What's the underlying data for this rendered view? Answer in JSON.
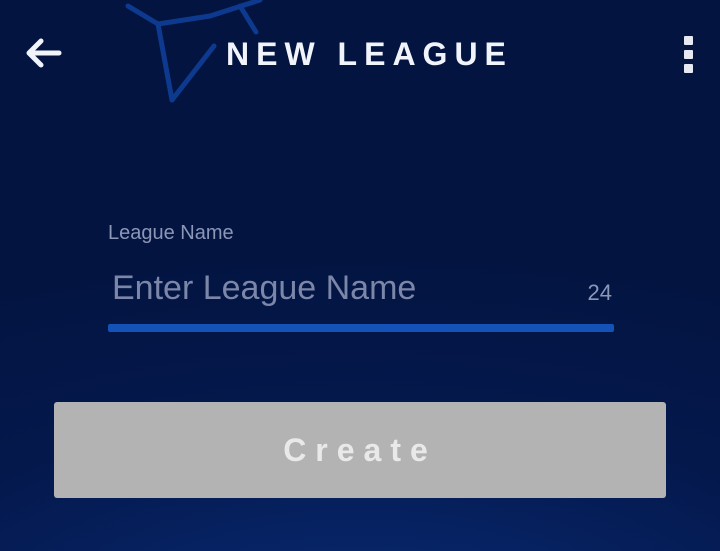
{
  "header": {
    "title": "NEW LEAGUE",
    "back_icon": "back-arrow-icon",
    "menu_icon": "more-vertical-icon"
  },
  "form": {
    "label": "League Name",
    "placeholder": "Enter League Name",
    "value": "",
    "counter": "24"
  },
  "actions": {
    "create_label": "Create"
  },
  "colors": {
    "background": "#04184c",
    "accent": "#1452b8",
    "button_disabled": "#b3b3b3"
  }
}
